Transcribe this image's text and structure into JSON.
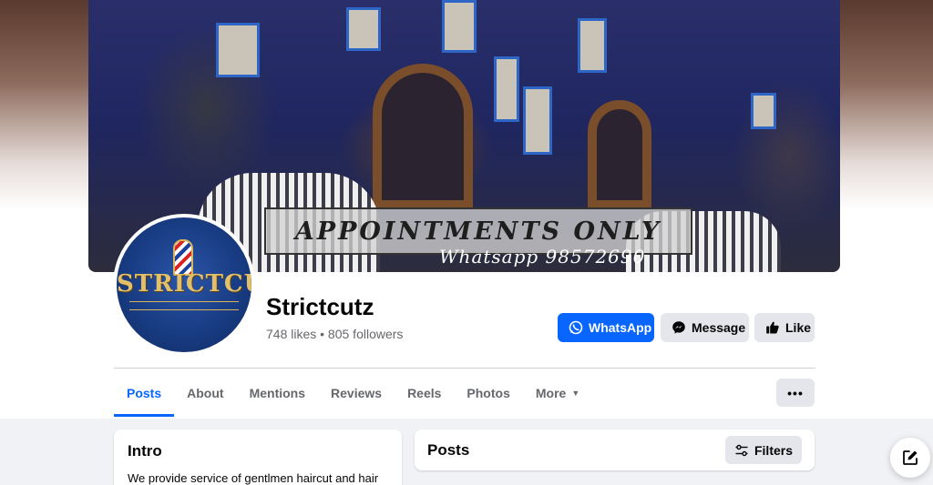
{
  "cover": {
    "banner_text": "APPOINTMENTS ONLY",
    "banner_subtext": "Whatsapp 98572690"
  },
  "avatar": {
    "logo_text": "STRICTCUTZ"
  },
  "profile": {
    "name": "Strictcutz",
    "stats": "748 likes • 805 followers"
  },
  "actions": {
    "whatsapp_label": "WhatsApp",
    "message_label": "Message",
    "like_label": "Like"
  },
  "tabs": [
    {
      "label": "Posts",
      "active": true
    },
    {
      "label": "About"
    },
    {
      "label": "Mentions"
    },
    {
      "label": "Reviews"
    },
    {
      "label": "Reels"
    },
    {
      "label": "Photos"
    },
    {
      "label": "More",
      "has_caret": true
    }
  ],
  "more_menu_label": "•••",
  "intro": {
    "title": "Intro",
    "text": "We provide service of gentlmen haircut and hair"
  },
  "posts": {
    "title": "Posts",
    "filters_label": "Filters"
  },
  "icons": {
    "whatsapp": "whatsapp-icon",
    "messenger": "messenger-icon",
    "like": "thumbs-up-icon",
    "filters": "sliders-icon",
    "compose": "compose-icon"
  },
  "colors": {
    "primary": "#0866ff",
    "secondary_bg": "#e4e6eb",
    "muted_text": "#65676b",
    "page_bg": "#f0f2f5"
  }
}
